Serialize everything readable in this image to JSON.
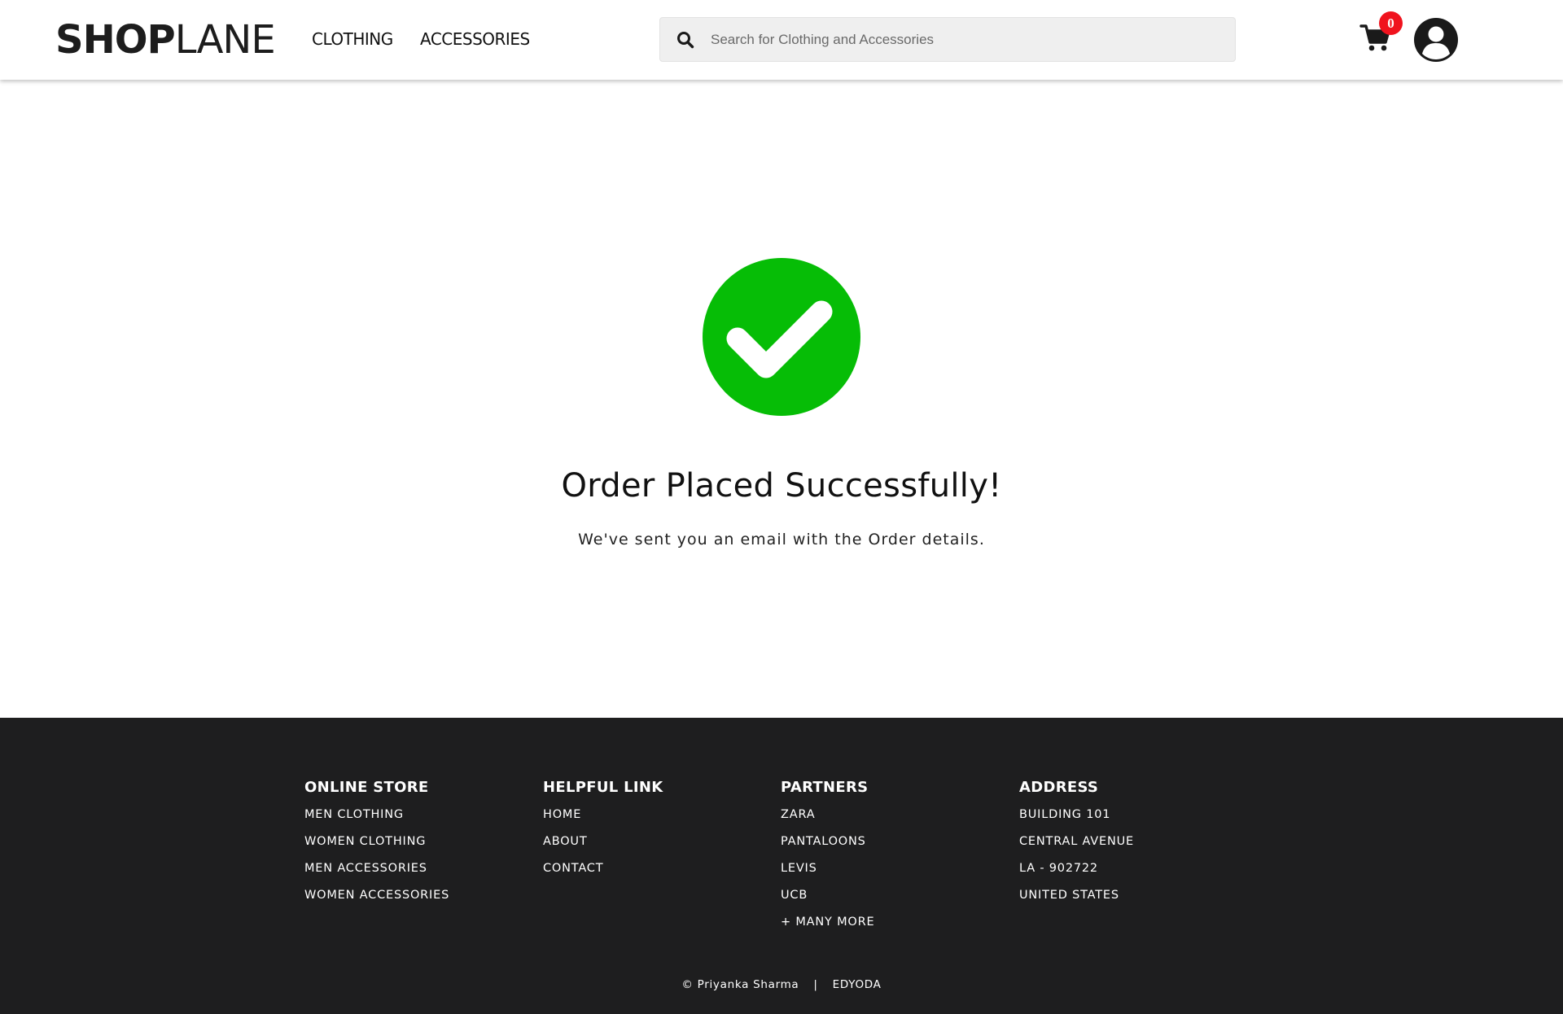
{
  "header": {
    "logo_bold": "SHOP",
    "logo_light": "LANE",
    "nav": [
      {
        "label": "CLOTHING"
      },
      {
        "label": "ACCESSORIES"
      }
    ],
    "search": {
      "placeholder": "Search for Clothing and Accessories",
      "value": ""
    },
    "cart": {
      "count": "0",
      "icon": "cart-icon"
    },
    "user": {
      "icon": "user-circle-icon"
    }
  },
  "main": {
    "success_icon": "check-circle-icon",
    "success_color": "#06bd06",
    "title": "Order Placed Successfully!",
    "subtitle": "We've sent you an email with the Order details."
  },
  "footer": {
    "columns": [
      {
        "heading": "ONLINE STORE",
        "items": [
          "MEN CLOTHING",
          "WOMEN CLOTHING",
          "MEN ACCESSORIES",
          "WOMEN ACCESSORIES"
        ]
      },
      {
        "heading": "HELPFUL LINK",
        "items": [
          "HOME",
          "ABOUT",
          "CONTACT"
        ]
      },
      {
        "heading": "PARTNERS",
        "items": [
          "ZARA",
          "PANTALOONS",
          "LEVIS",
          "UCB",
          "+ MANY MORE"
        ]
      },
      {
        "heading": "ADDRESS",
        "items": [
          "BUILDING 101",
          "CENTRAL AVENUE",
          "LA - 902722",
          "UNITED STATES"
        ]
      }
    ],
    "copyright": "© Priyanka Sharma",
    "separator": "|",
    "brand": "EDYODA",
    "background": "#1e1e1f"
  },
  "colors": {
    "badge": "#f0131e",
    "success": "#06bd06"
  }
}
